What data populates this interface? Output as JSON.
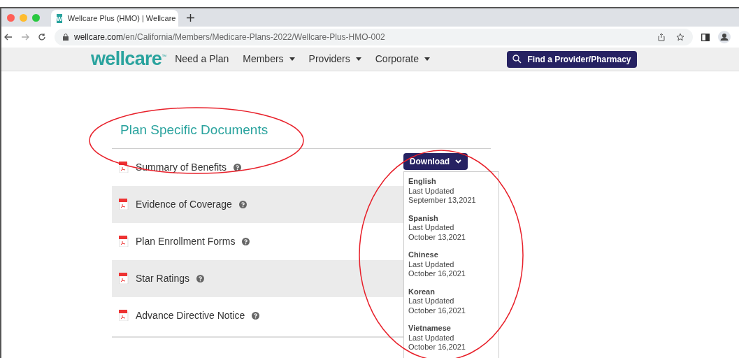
{
  "browser": {
    "tab_title": "Wellcare Plus (HMO) | Wellcare",
    "tab_favicon": "w",
    "url_domain": "wellcare.com",
    "url_path": "/en/California/Members/Medicare-Plans-2022/Wellcare-Plus-HMO-002"
  },
  "nav": {
    "logo": "wellcare",
    "logo_mark": "™",
    "items": [
      {
        "label": "Need a Plan",
        "dropdown": false
      },
      {
        "label": "Members",
        "dropdown": true
      },
      {
        "label": "Providers",
        "dropdown": true
      },
      {
        "label": "Corporate",
        "dropdown": true
      }
    ],
    "cta": "Find a Provider/Pharmacy"
  },
  "section": {
    "title": "Plan Specific Documents",
    "documents": [
      {
        "label": "Summary of Benefits"
      },
      {
        "label": "Evidence of Coverage"
      },
      {
        "label": "Plan Enrollment Forms"
      },
      {
        "label": "Star Ratings"
      },
      {
        "label": "Advance Directive Notice"
      }
    ]
  },
  "download": {
    "label": "Download",
    "options": [
      {
        "language": "English",
        "note": "Last Updated",
        "date": "September 13,2021"
      },
      {
        "language": "Spanish",
        "note": "Last Updated",
        "date": "October 13,2021"
      },
      {
        "language": "Chinese",
        "note": "Last Updated",
        "date": "October 16,2021"
      },
      {
        "language": "Korean",
        "note": "Last Updated",
        "date": "October 16,2021"
      },
      {
        "language": "Vietnamese",
        "note": "Last Updated",
        "date": "October 16,2021"
      }
    ]
  }
}
